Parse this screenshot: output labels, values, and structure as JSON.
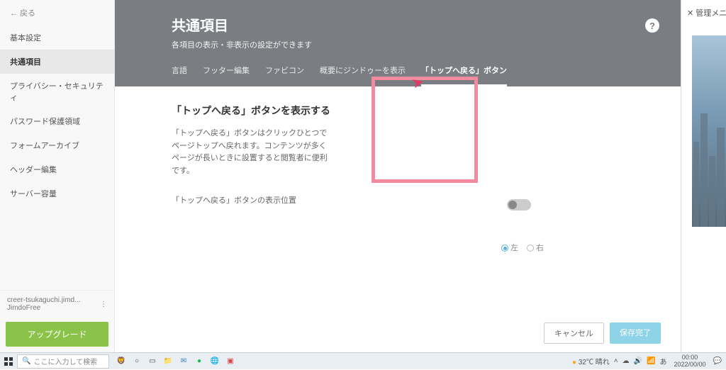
{
  "sidebar": {
    "back": "←  戻る",
    "items": [
      "基本設定",
      "共通項目",
      "プライバシー・セキュリティ",
      "パスワード保護領域",
      "フォームアーカイブ",
      "ヘッダー編集",
      "サーバー容量"
    ],
    "active_index": 1,
    "account": "creer-tsukaguchi.jimd...",
    "plan": "JimdoFree",
    "upgrade": "アップグレード"
  },
  "header": {
    "title": "共通項目",
    "subtitle": "各項目の表示・非表示の設定ができます",
    "help": "?",
    "tabs": [
      "言語",
      "フッター編集",
      "ファビコン",
      "概要にジンドゥーを表示",
      "「トップへ戻る」ボタン"
    ],
    "active_tab": 4
  },
  "section": {
    "title": "「トップへ戻る」ボタンを表示する",
    "desc": "「トップへ戻る」ボタンはクリックひとつでページトップへ戻れます。コンテンツが多くページが長いときに設置すると閲覧者に便利です。",
    "pos_label": "「トップへ戻る」ボタンの表示位置",
    "opt_left": "左",
    "opt_right": "右"
  },
  "buttons": {
    "cancel": "キャンセル",
    "save": "保存完了"
  },
  "right_panel": {
    "close": "✕ 管理メニ"
  },
  "taskbar": {
    "search_placeholder": "ここに入力して検索",
    "weather": "32℃ 晴れ",
    "time": "00:00",
    "date": "2022/00/00"
  }
}
